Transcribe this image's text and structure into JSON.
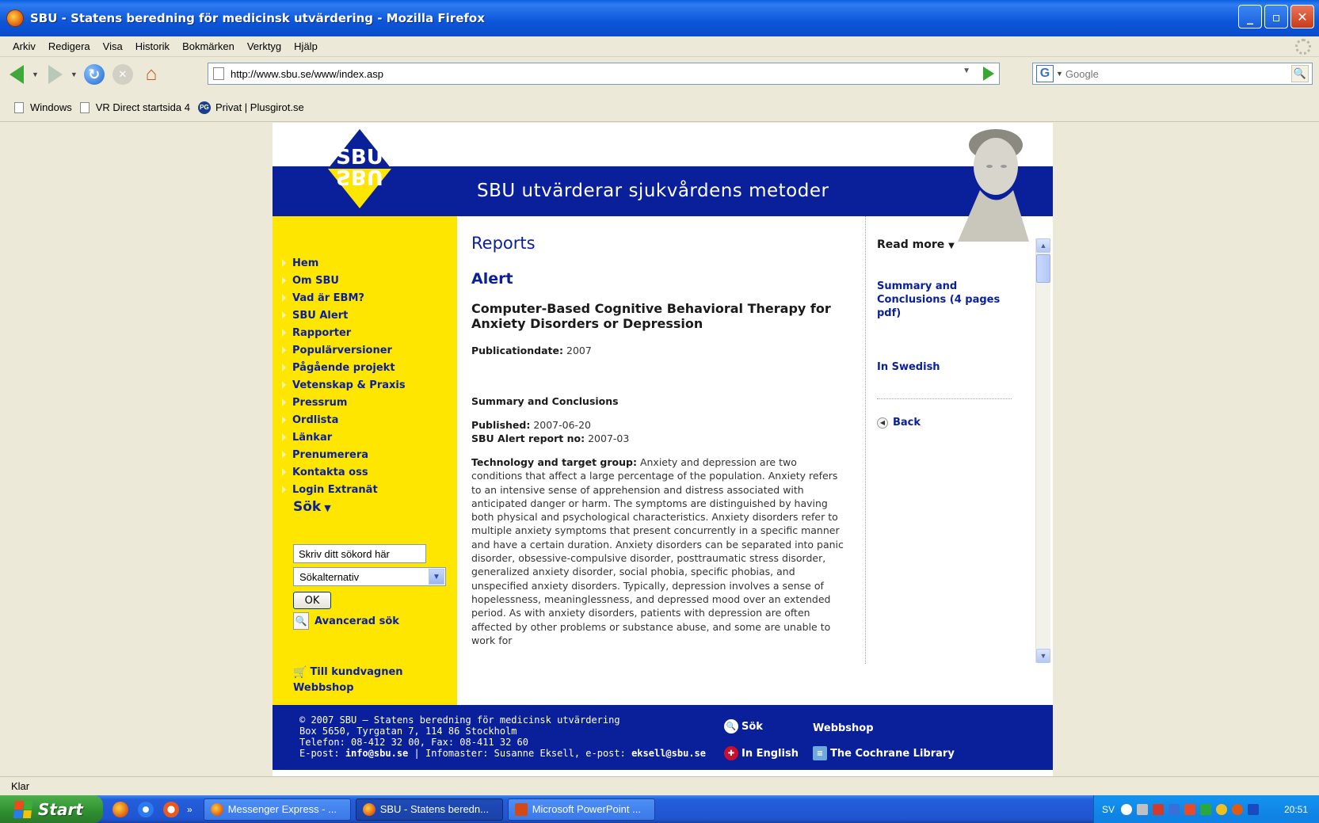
{
  "window": {
    "title": "SBU - Statens beredning för medicinsk utvärdering - Mozilla Firefox",
    "controls": [
      "_",
      "▫",
      "✕"
    ]
  },
  "menu": [
    "Arkiv",
    "Redigera",
    "Visa",
    "Historik",
    "Bokmärken",
    "Verktyg",
    "Hjälp"
  ],
  "nav": {
    "url": "http://www.sbu.se/www/index.asp",
    "search_engine": "G",
    "search_placeholder": "Google"
  },
  "bookmarks": [
    {
      "label": "Windows",
      "icon": "page-icon"
    },
    {
      "label": "VR Direct startsida 4",
      "icon": "page-icon"
    },
    {
      "label": "Privat | Plusgirot.se",
      "icon": "plusgirot-icon"
    }
  ],
  "site": {
    "tagline": "SBU utvärderar sjukvårdens metoder",
    "logo_text": "SBU",
    "colors": {
      "brand_blue": "#0a1f9a",
      "brand_yellow": "#ffe600"
    }
  },
  "sidebar": {
    "items": [
      "Hem",
      "Om SBU",
      "Vad är EBM?",
      "SBU Alert",
      "Rapporter",
      "Populärversioner",
      "Pågående projekt",
      "Vetenskap & Praxis",
      "Pressrum",
      "Ordlista",
      "Länkar",
      "Prenumerera",
      "Kontakta oss",
      "Login Extranät"
    ],
    "search_heading": "Sök",
    "search_value": "Skriv ditt sökord här",
    "search_option": "Sökalternativ",
    "ok_label": "OK",
    "advanced_label": "Avancerad sök",
    "cart_label": "Till kundvagnen",
    "webshop_label": "Webbshop"
  },
  "main": {
    "section": "Reports",
    "category": "Alert",
    "title": "Computer-Based Cognitive Behavioral Therapy for Anxiety Disorders or Depression",
    "pubdate_label": "Publicationdate:",
    "pubdate": "2007",
    "summary_heading": "Summary and Conclusions",
    "published_label": "Published:",
    "published": "2007-06-20",
    "report_label": "SBU Alert report no:",
    "report_no": "2007-03",
    "body_label": "Technology and target group:",
    "body": "Anxiety and depression are two conditions that affect a large percentage of the population. Anxiety refers to an intensive sense of apprehension and distress associated with anticipated danger or harm. The symptoms are distinguished by having both physical and psychological characteristics. Anxiety disorders refer to multiple anxiety symptoms that present concurrently in a specific manner and have a certain duration. Anxiety disorders can be separated into panic disorder, obsessive-compulsive disorder, posttraumatic stress disorder, generalized anxiety disorder, social phobia, specific phobias, and unspecified anxiety disorders. Typically, depression involves a sense of hopelessness, meaninglessness, and depressed mood over an extended period. As with anxiety disorders, patients with depression are often affected by other problems or substance abuse, and some are unable to work for"
  },
  "right": {
    "heading": "Read more",
    "summary_link": "Summary and Conclusions (4 pages pdf)",
    "swedish_link": "In Swedish",
    "back_label": "Back"
  },
  "footer": {
    "line1": "© 2007 SBU – Statens beredning för medicinsk utvärdering",
    "line2": "Box 5650, Tyrgatan 7, 114 86 Stockholm",
    "line3": "Telefon: 08-412 32 00, Fax: 08-411 32 60",
    "line4_prefix": "E-post:",
    "line4_email": "info@sbu.se",
    "line4_mid": "| Infomaster: Susanne Eksell, e-post:",
    "line4_email2": "eksell@sbu.se",
    "sok": "Sök",
    "webbshop": "Webbshop",
    "english": "In English",
    "cochrane": "The Cochrane Library"
  },
  "status": "Klar",
  "taskbar": {
    "start": "Start",
    "tasks": [
      "Messenger Express - ...",
      "SBU - Statens beredn...",
      "Microsoft PowerPoint ..."
    ],
    "lang": "SV",
    "clock": "20:51"
  }
}
